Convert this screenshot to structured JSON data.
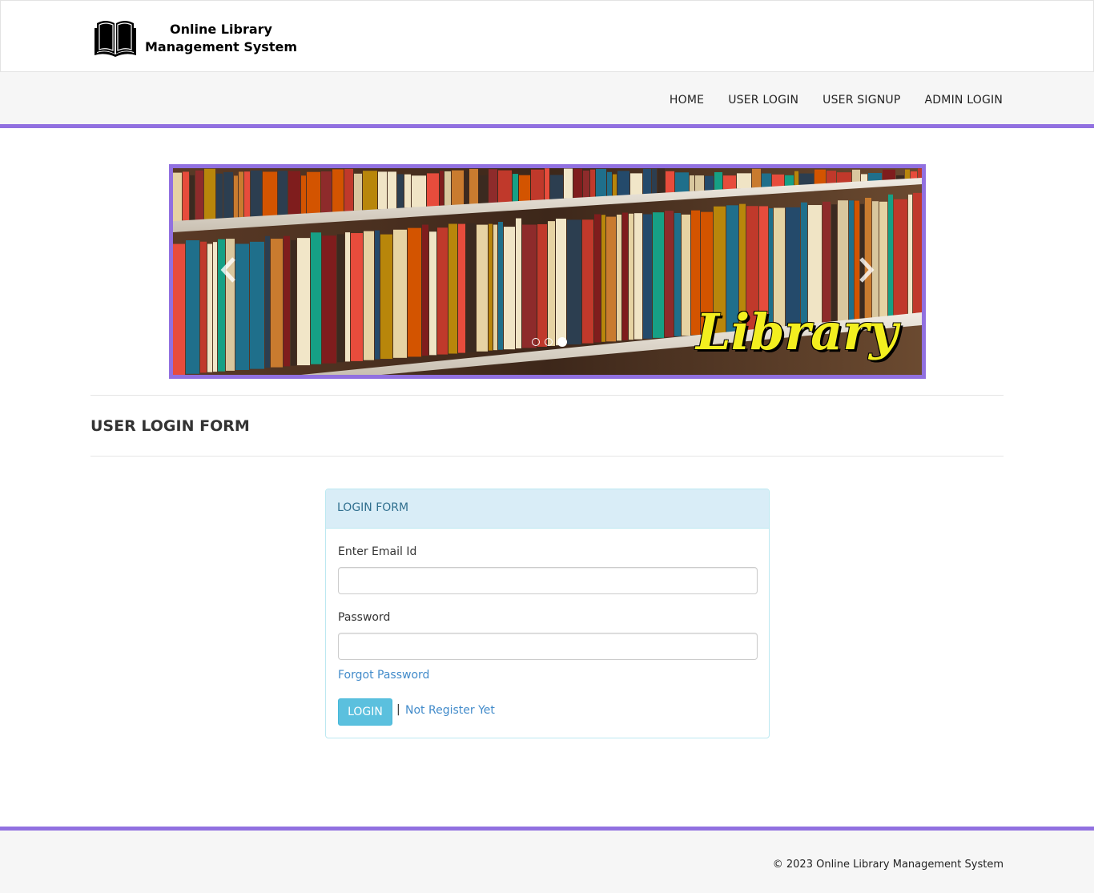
{
  "header": {
    "logo_line1": "Online Library",
    "logo_line2": "Management System",
    "logo_icon": "open-book-icon"
  },
  "nav": {
    "items": [
      {
        "label": "HOME"
      },
      {
        "label": "USER LOGIN"
      },
      {
        "label": "USER SIGNUP"
      },
      {
        "label": "ADMIN LOGIN"
      }
    ]
  },
  "carousel": {
    "caption": "Library",
    "prev_icon": "chevron-left-icon",
    "next_icon": "chevron-right-icon",
    "slide_count": 3,
    "active_slide": 3
  },
  "page": {
    "title": "USER LOGIN FORM"
  },
  "login_form": {
    "heading": "LOGIN FORM",
    "email_label": "Enter Email Id",
    "email_value": "",
    "password_label": "Password",
    "password_value": "",
    "forgot_link": "Forgot Password",
    "login_button": "LOGIN",
    "separator": "|",
    "register_link": "Not Register Yet"
  },
  "footer": {
    "text": "© 2023 Online Library Management System"
  },
  "colors": {
    "accent": "#9170e0",
    "login_button": "#5bc0de",
    "link": "#428bca",
    "panel_heading_bg": "#d9edf7",
    "panel_heading_text": "#31708f",
    "caption": "#f3ef1f"
  }
}
